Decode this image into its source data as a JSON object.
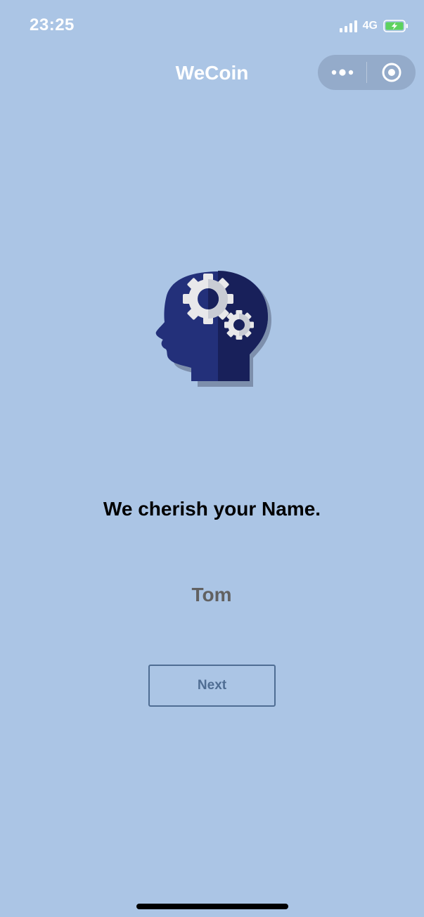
{
  "status_bar": {
    "time": "23:25",
    "network": "4G",
    "signal_icon": "signal-bars-icon",
    "battery_icon": "battery-charging-icon"
  },
  "nav": {
    "title": "WeCoin",
    "more_icon": "more-dots-icon",
    "close_icon": "target-circle-icon"
  },
  "illustration": {
    "icon": "head-gears-icon"
  },
  "main": {
    "prompt": "We cherish your Name.",
    "name_value": "Tom",
    "next_label": "Next"
  },
  "colors": {
    "background": "#abc5e5",
    "head_primary": "#23307a",
    "head_shadow": "#18205a",
    "gear": "#e8e8ea",
    "button_border": "#4f6d93",
    "input_text": "#616161"
  }
}
